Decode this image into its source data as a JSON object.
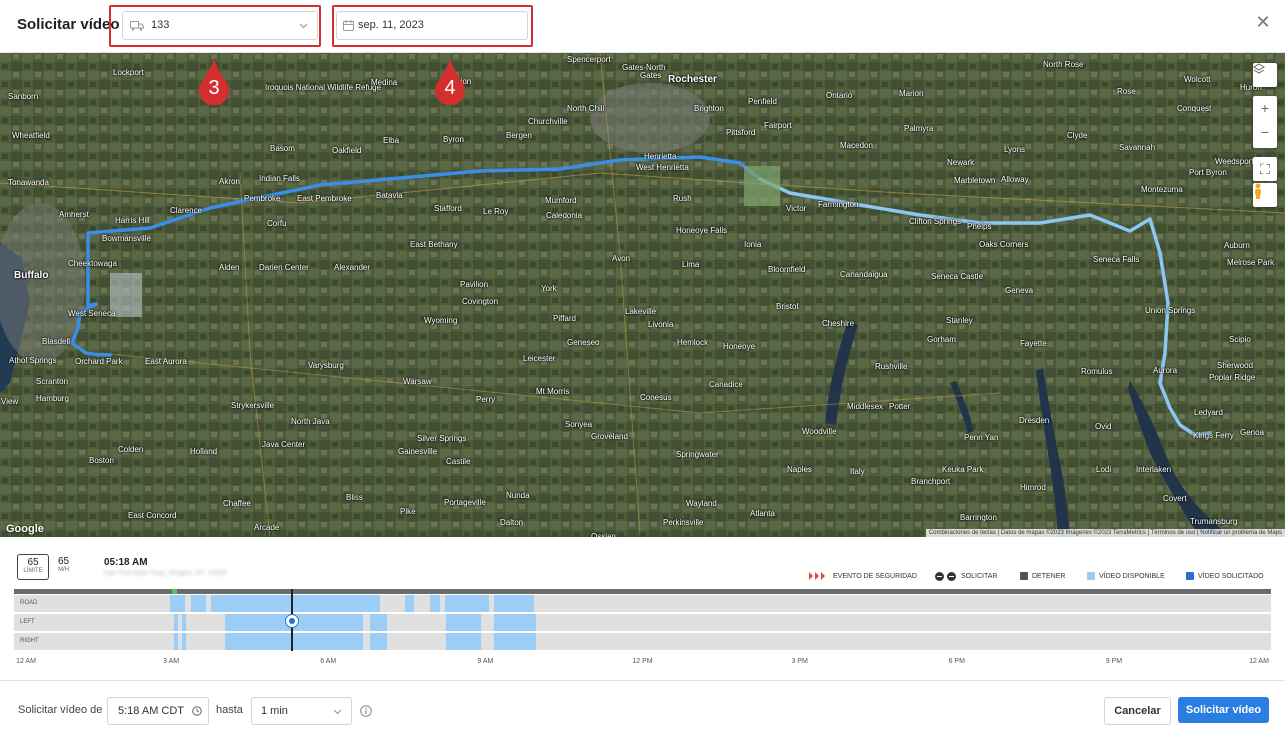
{
  "header": {
    "title": "Solicitar vídeo",
    "vehicle_value": "133",
    "date_value": "sep. 11, 2023"
  },
  "annotations": [
    "3",
    "4"
  ],
  "map": {
    "places": [
      {
        "name": "Rochester",
        "big": true,
        "pos": [
          668,
          74
        ]
      },
      {
        "name": "Spencerport",
        "pos": [
          567,
          55
        ]
      },
      {
        "name": "Gates-North",
        "pos": [
          622,
          63
        ]
      },
      {
        "name": "Gates",
        "pos": [
          640,
          71
        ]
      },
      {
        "name": "Lockport",
        "pos": [
          113,
          68
        ]
      },
      {
        "name": "Sanborn",
        "pos": [
          8,
          92
        ]
      },
      {
        "name": "Iroquois National Wildlife Refuge",
        "pos": [
          265,
          83
        ]
      },
      {
        "name": "Medina",
        "pos": [
          371,
          78
        ]
      },
      {
        "name": "Albion",
        "pos": [
          449,
          77
        ]
      },
      {
        "name": "Brighton",
        "pos": [
          694,
          104
        ]
      },
      {
        "name": "Penfield",
        "pos": [
          748,
          97
        ]
      },
      {
        "name": "North Chili",
        "pos": [
          567,
          104
        ]
      },
      {
        "name": "Churchville",
        "pos": [
          528,
          117
        ]
      },
      {
        "name": "Pittsford",
        "pos": [
          726,
          128
        ]
      },
      {
        "name": "Fairport",
        "pos": [
          764,
          121
        ]
      },
      {
        "name": "Wheatfield",
        "pos": [
          12,
          131
        ]
      },
      {
        "name": "Basom",
        "pos": [
          270,
          144
        ]
      },
      {
        "name": "Oakfield",
        "pos": [
          332,
          146
        ]
      },
      {
        "name": "Elba",
        "pos": [
          383,
          136
        ]
      },
      {
        "name": "Byron",
        "pos": [
          443,
          135
        ]
      },
      {
        "name": "Bergen",
        "pos": [
          506,
          131
        ]
      },
      {
        "name": "Henrietta",
        "pos": [
          644,
          152
        ]
      },
      {
        "name": "West Henrietta",
        "pos": [
          636,
          163
        ]
      },
      {
        "name": "Tonawanda",
        "pos": [
          8,
          178
        ]
      },
      {
        "name": "Akron",
        "pos": [
          219,
          177
        ]
      },
      {
        "name": "Indian Falls",
        "pos": [
          259,
          174
        ]
      },
      {
        "name": "Pembroke",
        "pos": [
          244,
          194
        ]
      },
      {
        "name": "East Pembroke",
        "pos": [
          297,
          194
        ]
      },
      {
        "name": "Batavia",
        "pos": [
          376,
          191
        ]
      },
      {
        "name": "Amherst",
        "pos": [
          59,
          210
        ]
      },
      {
        "name": "Harris Hill",
        "pos": [
          115,
          216
        ]
      },
      {
        "name": "Clarence",
        "pos": [
          170,
          206
        ]
      },
      {
        "name": "Corfu",
        "pos": [
          267,
          219
        ]
      },
      {
        "name": "Stafford",
        "pos": [
          434,
          204
        ]
      },
      {
        "name": "Le Roy",
        "pos": [
          483,
          207
        ]
      },
      {
        "name": "Mumford",
        "pos": [
          545,
          196
        ]
      },
      {
        "name": "Caledonia",
        "pos": [
          546,
          211
        ]
      },
      {
        "name": "Rush",
        "pos": [
          673,
          194
        ]
      },
      {
        "name": "Victor",
        "pos": [
          786,
          204
        ]
      },
      {
        "name": "Farmington",
        "pos": [
          818,
          200
        ]
      },
      {
        "name": "Bowmansville",
        "pos": [
          102,
          234
        ]
      },
      {
        "name": "Cheektowaga",
        "pos": [
          68,
          259
        ]
      },
      {
        "name": "Buffalo",
        "big": true,
        "pos": [
          14,
          270
        ]
      },
      {
        "name": "Alden",
        "pos": [
          219,
          263
        ]
      },
      {
        "name": "Darien Center",
        "pos": [
          259,
          263
        ]
      },
      {
        "name": "Alexander",
        "pos": [
          334,
          263
        ]
      },
      {
        "name": "East Bethany",
        "pos": [
          410,
          240
        ]
      },
      {
        "name": "Honeoye Falls",
        "pos": [
          676,
          226
        ]
      },
      {
        "name": "Ionia",
        "pos": [
          744,
          240
        ]
      },
      {
        "name": "Avon",
        "pos": [
          612,
          254
        ]
      },
      {
        "name": "Lima",
        "pos": [
          682,
          260
        ]
      },
      {
        "name": "Bloomfield",
        "pos": [
          768,
          265
        ]
      },
      {
        "name": "Canandaigua",
        "pos": [
          840,
          270
        ]
      },
      {
        "name": "West Seneca",
        "pos": [
          68,
          309
        ]
      },
      {
        "name": "Blasdell",
        "pos": [
          42,
          337
        ]
      },
      {
        "name": "Pavilion",
        "pos": [
          460,
          280
        ]
      },
      {
        "name": "Covington",
        "pos": [
          462,
          297
        ]
      },
      {
        "name": "York",
        "pos": [
          541,
          284
        ]
      },
      {
        "name": "Lakeville",
        "pos": [
          625,
          307
        ]
      },
      {
        "name": "Livonia",
        "pos": [
          648,
          320
        ]
      },
      {
        "name": "Bristol",
        "pos": [
          776,
          302
        ]
      },
      {
        "name": "Wyoming",
        "pos": [
          424,
          316
        ]
      },
      {
        "name": "Piffard",
        "pos": [
          553,
          314
        ]
      },
      {
        "name": "Geneseo",
        "pos": [
          567,
          338
        ]
      },
      {
        "name": "Hemlock",
        "pos": [
          677,
          338
        ]
      },
      {
        "name": "Honeoye",
        "pos": [
          723,
          342
        ]
      },
      {
        "name": "Cheshire",
        "pos": [
          822,
          319
        ]
      },
      {
        "name": "Athol Springs",
        "pos": [
          9,
          356
        ]
      },
      {
        "name": "Orchard Park",
        "pos": [
          75,
          357
        ]
      },
      {
        "name": "East Aurora",
        "pos": [
          145,
          357
        ]
      },
      {
        "name": "Varysburg",
        "pos": [
          308,
          361
        ]
      },
      {
        "name": "Leicester",
        "pos": [
          523,
          354
        ]
      },
      {
        "name": "Scranton",
        "pos": [
          36,
          377
        ]
      },
      {
        "name": "Hamburg",
        "pos": [
          36,
          394
        ]
      },
      {
        "name": "Warsaw",
        "pos": [
          403,
          377
        ]
      },
      {
        "name": "Mt Morris",
        "pos": [
          536,
          387
        ]
      },
      {
        "name": "Canadice",
        "pos": [
          709,
          380
        ]
      },
      {
        "name": "Conesus",
        "pos": [
          640,
          393
        ]
      },
      {
        "name": "Perry",
        "pos": [
          476,
          395
        ]
      },
      {
        "name": "Strykersville",
        "pos": [
          231,
          401
        ]
      },
      {
        "name": "North Java",
        "pos": [
          291,
          417
        ]
      },
      {
        "name": "Sonyea",
        "pos": [
          565,
          420
        ]
      },
      {
        "name": "Groveland",
        "pos": [
          591,
          432
        ]
      },
      {
        "name": "Java Center",
        "pos": [
          262,
          440
        ]
      },
      {
        "name": "Colden",
        "pos": [
          118,
          445
        ]
      },
      {
        "name": "Holland",
        "pos": [
          190,
          447
        ]
      },
      {
        "name": "Silver Springs",
        "pos": [
          417,
          434
        ]
      },
      {
        "name": "Gainesville",
        "pos": [
          398,
          447
        ]
      },
      {
        "name": "Castile",
        "pos": [
          446,
          457
        ]
      },
      {
        "name": "Springwater",
        "pos": [
          676,
          450
        ]
      },
      {
        "name": "Boston",
        "pos": [
          89,
          456
        ]
      },
      {
        "name": "Naples",
        "pos": [
          787,
          465
        ]
      },
      {
        "name": "Italy",
        "pos": [
          850,
          467
        ]
      },
      {
        "name": "Bliss",
        "pos": [
          346,
          493
        ]
      },
      {
        "name": "Portageville",
        "pos": [
          444,
          498
        ]
      },
      {
        "name": "Nunda",
        "pos": [
          506,
          491
        ]
      },
      {
        "name": "Wayland",
        "pos": [
          686,
          499
        ]
      },
      {
        "name": "Chaffee",
        "pos": [
          223,
          499
        ]
      },
      {
        "name": "East Concord",
        "pos": [
          128,
          511
        ]
      },
      {
        "name": "Pike",
        "pos": [
          400,
          507
        ]
      },
      {
        "name": "Dalton",
        "pos": [
          500,
          518
        ]
      },
      {
        "name": "Perkinsville",
        "pos": [
          663,
          518
        ]
      },
      {
        "name": "Atlanta",
        "pos": [
          750,
          509
        ]
      },
      {
        "name": "Arcade",
        "pos": [
          254,
          523
        ]
      },
      {
        "name": "Ossian",
        "pos": [
          591,
          532
        ]
      },
      {
        "name": "Marion",
        "pos": [
          899,
          89
        ]
      },
      {
        "name": "Ontario",
        "pos": [
          826,
          91
        ]
      },
      {
        "name": "Macedon",
        "pos": [
          840,
          141
        ]
      },
      {
        "name": "Palmyra",
        "pos": [
          904,
          124
        ]
      },
      {
        "name": "Newark",
        "pos": [
          947,
          158
        ]
      },
      {
        "name": "Marbletown",
        "pos": [
          954,
          176
        ]
      },
      {
        "name": "Lyons",
        "pos": [
          1004,
          145
        ]
      },
      {
        "name": "Clyde",
        "pos": [
          1067,
          131
        ]
      },
      {
        "name": "Savannah",
        "pos": [
          1119,
          143
        ]
      },
      {
        "name": "North Rose",
        "pos": [
          1043,
          60
        ]
      },
      {
        "name": "Wolcott",
        "pos": [
          1184,
          75
        ]
      },
      {
        "name": "Huron",
        "pos": [
          1240,
          83
        ]
      },
      {
        "name": "Rose",
        "pos": [
          1117,
          87
        ]
      },
      {
        "name": "Conquest",
        "pos": [
          1177,
          104
        ]
      },
      {
        "name": "Weedsport",
        "pos": [
          1215,
          157
        ]
      },
      {
        "name": "Port Byron",
        "pos": [
          1189,
          168
        ]
      },
      {
        "name": "Alloway",
        "pos": [
          1001,
          175
        ]
      },
      {
        "name": "Montezuma",
        "pos": [
          1141,
          185
        ]
      },
      {
        "name": "Clifton Springs",
        "pos": [
          909,
          217
        ]
      },
      {
        "name": "Phelps",
        "pos": [
          967,
          222
        ]
      },
      {
        "name": "Oaks Corners",
        "pos": [
          979,
          240
        ]
      },
      {
        "name": "Seneca Falls",
        "pos": [
          1093,
          255
        ]
      },
      {
        "name": "Auburn",
        "pos": [
          1224,
          241
        ]
      },
      {
        "name": "Melrose Park",
        "pos": [
          1227,
          258
        ]
      },
      {
        "name": "Seneca Castle",
        "pos": [
          931,
          272
        ]
      },
      {
        "name": "Geneva",
        "pos": [
          1005,
          286
        ]
      },
      {
        "name": "Union Springs",
        "pos": [
          1145,
          306
        ]
      },
      {
        "name": "Stanley",
        "pos": [
          946,
          316
        ]
      },
      {
        "name": "Gorham",
        "pos": [
          927,
          335
        ]
      },
      {
        "name": "Fayette",
        "pos": [
          1020,
          339
        ]
      },
      {
        "name": "Rushville",
        "pos": [
          875,
          362
        ]
      },
      {
        "name": "Romulus",
        "pos": [
          1081,
          367
        ]
      },
      {
        "name": "Sherwood",
        "pos": [
          1217,
          361
        ]
      },
      {
        "name": "Scipio",
        "pos": [
          1229,
          335
        ]
      },
      {
        "name": "Aurora",
        "pos": [
          1153,
          366
        ]
      },
      {
        "name": "Poplar Ridge",
        "pos": [
          1209,
          373
        ]
      },
      {
        "name": "Middlesex",
        "pos": [
          847,
          402
        ]
      },
      {
        "name": "Potter",
        "pos": [
          889,
          402
        ]
      },
      {
        "name": "Ledyard",
        "pos": [
          1194,
          408
        ]
      },
      {
        "name": "Dresden",
        "pos": [
          1019,
          416
        ]
      },
      {
        "name": "Ovid",
        "pos": [
          1095,
          422
        ]
      },
      {
        "name": "Woodville",
        "pos": [
          802,
          427
        ]
      },
      {
        "name": "Penn Yan",
        "pos": [
          964,
          433
        ]
      },
      {
        "name": "Genoa",
        "pos": [
          1240,
          428
        ]
      },
      {
        "name": "Kings Ferry",
        "pos": [
          1193,
          431
        ]
      },
      {
        "name": "Lodi",
        "pos": [
          1096,
          465
        ]
      },
      {
        "name": "Interlaken",
        "pos": [
          1136,
          465
        ]
      },
      {
        "name": "Keuka Park",
        "pos": [
          942,
          465
        ]
      },
      {
        "name": "Branchport",
        "pos": [
          911,
          477
        ]
      },
      {
        "name": "Himrod",
        "pos": [
          1020,
          483
        ]
      },
      {
        "name": "Covert",
        "pos": [
          1163,
          494
        ]
      },
      {
        "name": "Barrington",
        "pos": [
          960,
          513
        ]
      },
      {
        "name": "Trumansburg",
        "pos": [
          1190,
          517
        ]
      },
      {
        "name": "View",
        "pos": [
          1,
          397
        ]
      }
    ],
    "attribution": [
      "Combinaciones de teclas",
      "Datos de mapas ©2023 Imágenes ©2023 TerraMetrics",
      "Términos de uso",
      "Notificar un problema de Maps"
    ],
    "google_label": "Google"
  },
  "info": {
    "limit_value": "65",
    "limit_label": "LÍMITE",
    "speed_value": "65",
    "speed_unit": "M/H",
    "time": "05:18 AM",
    "address": "Dan Test Bald Tway, Pelgkin, NY 14303"
  },
  "legend": [
    {
      "label": "EVENTO DE SEGURIDAD",
      "type": "safety"
    },
    {
      "label": "SOLICITAR",
      "type": "request"
    },
    {
      "label": "DETENER",
      "type": "stop",
      "color": "#4a5563"
    },
    {
      "label": "VÍDEO DISPONIBLE",
      "type": "avail",
      "color": "#9ccdf7"
    },
    {
      "label": "VÍDEO SOLICITADO",
      "type": "requested",
      "color": "#2a6fd0"
    }
  ],
  "tracks": [
    {
      "label": "ROAD",
      "segments": [
        [
          0.124,
          0.136
        ],
        [
          0.141,
          0.153
        ],
        [
          0.157,
          0.291
        ],
        [
          0.311,
          0.318
        ],
        [
          0.331,
          0.339
        ],
        [
          0.343,
          0.378
        ],
        [
          0.382,
          0.414
        ]
      ]
    },
    {
      "label": "LEFT",
      "segments": [
        [
          0.1275,
          0.1305
        ],
        [
          0.1335,
          0.1365
        ],
        [
          0.1675,
          0.2775
        ],
        [
          0.2835,
          0.2965
        ],
        [
          0.3435,
          0.3715
        ],
        [
          0.3815,
          0.4155
        ]
      ]
    },
    {
      "label": "RIGHT",
      "segments": [
        [
          0.1275,
          0.1305
        ],
        [
          0.1335,
          0.1365
        ],
        [
          0.1675,
          0.2775
        ],
        [
          0.2835,
          0.2965
        ],
        [
          0.3435,
          0.3715
        ],
        [
          0.3815,
          0.4155
        ]
      ]
    }
  ],
  "cursor_fraction": 0.2215,
  "axis_ticks": [
    "12 AM",
    "3 AM",
    "6 AM",
    "9 AM",
    "12 PM",
    "3 PM",
    "6 PM",
    "9 PM",
    "12 AM"
  ],
  "footer": {
    "from_label": "Solicitar vídeo de",
    "from_value": "5:18 AM CDT",
    "to_label": "hasta",
    "duration_value": "1 min",
    "cancel_label": "Cancelar",
    "submit_label": "Solicitar vídeo"
  },
  "colors": {
    "accent": "#2a7de1",
    "highlight": "#d32f2f",
    "route": "#3a8ee8",
    "route_light": "#8cc6f5"
  }
}
